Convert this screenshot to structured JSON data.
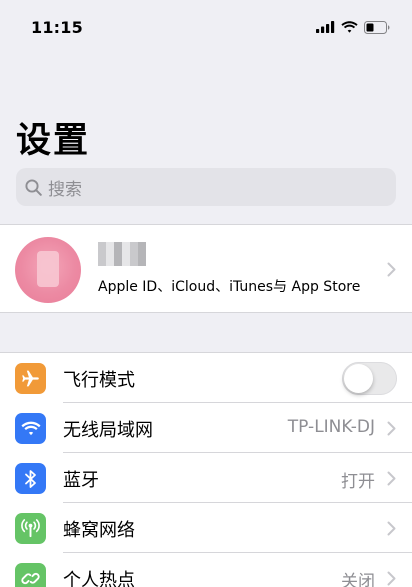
{
  "status_bar": {
    "time": "11:15",
    "icons": [
      "cellular-signal-icon",
      "wifi-icon",
      "battery-icon"
    ]
  },
  "page": {
    "title": "设置"
  },
  "search": {
    "placeholder": "搜索",
    "icon": "search-icon"
  },
  "profile": {
    "subtitle": "Apple ID、iCloud、iTunes与 App Store",
    "icon": "chevron-right-icon"
  },
  "settings": [
    {
      "label": "飞行模式",
      "value": "",
      "icon": "airplane-icon",
      "color": "#f19a38",
      "accessory": "toggle",
      "toggle_on": false
    },
    {
      "label": "无线局域网",
      "value": "TP-LINK-DJ",
      "icon": "wifi-icon",
      "color": "#3478f6",
      "accessory": "chevron"
    },
    {
      "label": "蓝牙",
      "value": "打开",
      "icon": "bluetooth-icon",
      "color": "#3478f6",
      "accessory": "chevron"
    },
    {
      "label": "蜂窝网络",
      "value": "",
      "icon": "antenna-icon",
      "color": "#65c466",
      "accessory": "chevron"
    },
    {
      "label": "个人热点",
      "value": "关闭",
      "icon": "hotspot-link-icon",
      "color": "#65c466",
      "accessory": "chevron"
    }
  ],
  "colors": {
    "background": "#efeff4",
    "secondary_text": "#8e8e93",
    "chevron": "#c7c7cc"
  }
}
